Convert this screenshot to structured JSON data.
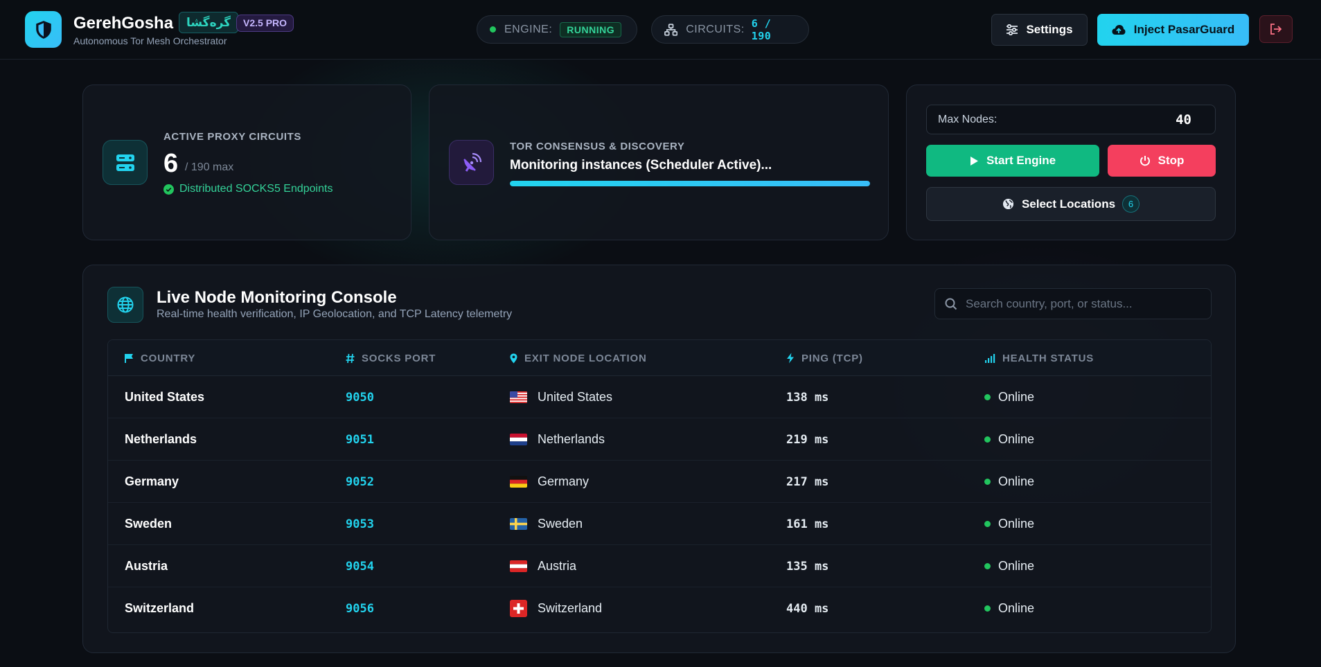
{
  "header": {
    "brand": "GerehGosha",
    "brand_fa": "گره‌گشا",
    "version": "V2.5 PRO",
    "subtitle": "Autonomous Tor Mesh Orchestrator",
    "engine_label": "ENGINE:",
    "engine_status": "RUNNING",
    "circuits_label": "CIRCUITS:",
    "circuits_value": "6 / 190",
    "settings_label": "Settings",
    "inject_label": "Inject PasarGuard"
  },
  "active_card": {
    "title": "ACTIVE PROXY CIRCUITS",
    "count": "6",
    "max": "/ 190 max",
    "note": "Distributed SOCKS5 Endpoints"
  },
  "tor_card": {
    "title": "TOR CONSENSUS & DISCOVERY",
    "status": "Monitoring instances (Scheduler Active)...",
    "progress": 1.0
  },
  "controls": {
    "max_nodes_label": "Max Nodes:",
    "max_nodes_value": "40",
    "start_label": "Start Engine",
    "stop_label": "Stop",
    "locations_label": "Select Locations",
    "locations_count": "6"
  },
  "console": {
    "title": "Live Node Monitoring Console",
    "subtitle": "Real-time health verification, IP Geolocation, and TCP Latency telemetry",
    "search_placeholder": "Search country, port, or status...",
    "columns": [
      "COUNTRY",
      "SOCKS PORT",
      "EXIT NODE LOCATION",
      "PING (TCP)",
      "HEALTH STATUS"
    ],
    "rows": [
      {
        "country": "United States",
        "port": "9050",
        "location": "United States",
        "flag": "us",
        "ping": "138 ms",
        "status": "Online"
      },
      {
        "country": "Netherlands",
        "port": "9051",
        "location": "Netherlands",
        "flag": "nl",
        "ping": "219 ms",
        "status": "Online"
      },
      {
        "country": "Germany",
        "port": "9052",
        "location": "Germany",
        "flag": "de",
        "ping": "217 ms",
        "status": "Online"
      },
      {
        "country": "Sweden",
        "port": "9053",
        "location": "Sweden",
        "flag": "se",
        "ping": "161 ms",
        "status": "Online"
      },
      {
        "country": "Austria",
        "port": "9054",
        "location": "Austria",
        "flag": "at",
        "ping": "135 ms",
        "status": "Online"
      },
      {
        "country": "Switzerland",
        "port": "9056",
        "location": "Switzerland",
        "flag": "ch",
        "ping": "440 ms",
        "status": "Online"
      }
    ]
  },
  "colors": {
    "accent": "#22d3ee",
    "success": "#10b981",
    "danger": "#f43f5e",
    "purple": "#8b5cf6",
    "online": "#22c55e"
  },
  "icons": {
    "logo": "shield-icon",
    "engine": "status-dot-icon",
    "circuits": "sitemap-icon",
    "settings": "sliders-icon",
    "inject": "cloud-upload-icon",
    "logout": "sign-out-icon",
    "active": "server-icon",
    "tor": "satellite-dish-icon",
    "start": "play-icon",
    "stop": "power-icon",
    "locations": "globe-icon",
    "console": "globe-icon",
    "search": "search-icon"
  }
}
